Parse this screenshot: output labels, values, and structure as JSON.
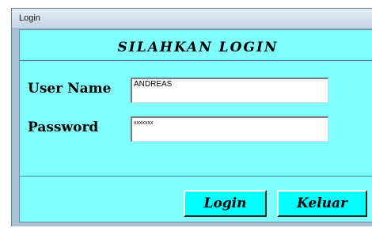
{
  "window": {
    "title": "Login"
  },
  "form": {
    "heading": "SILAHKAN LOGIN",
    "username": {
      "label": "User Name",
      "value": "ANDREAS"
    },
    "password": {
      "label": "Password",
      "value": "xxxxxxx"
    },
    "buttons": {
      "login": "Login",
      "keluar": "Keluar"
    }
  },
  "colors": {
    "form_background": "#80ffff",
    "button_background": "#00ffff"
  }
}
